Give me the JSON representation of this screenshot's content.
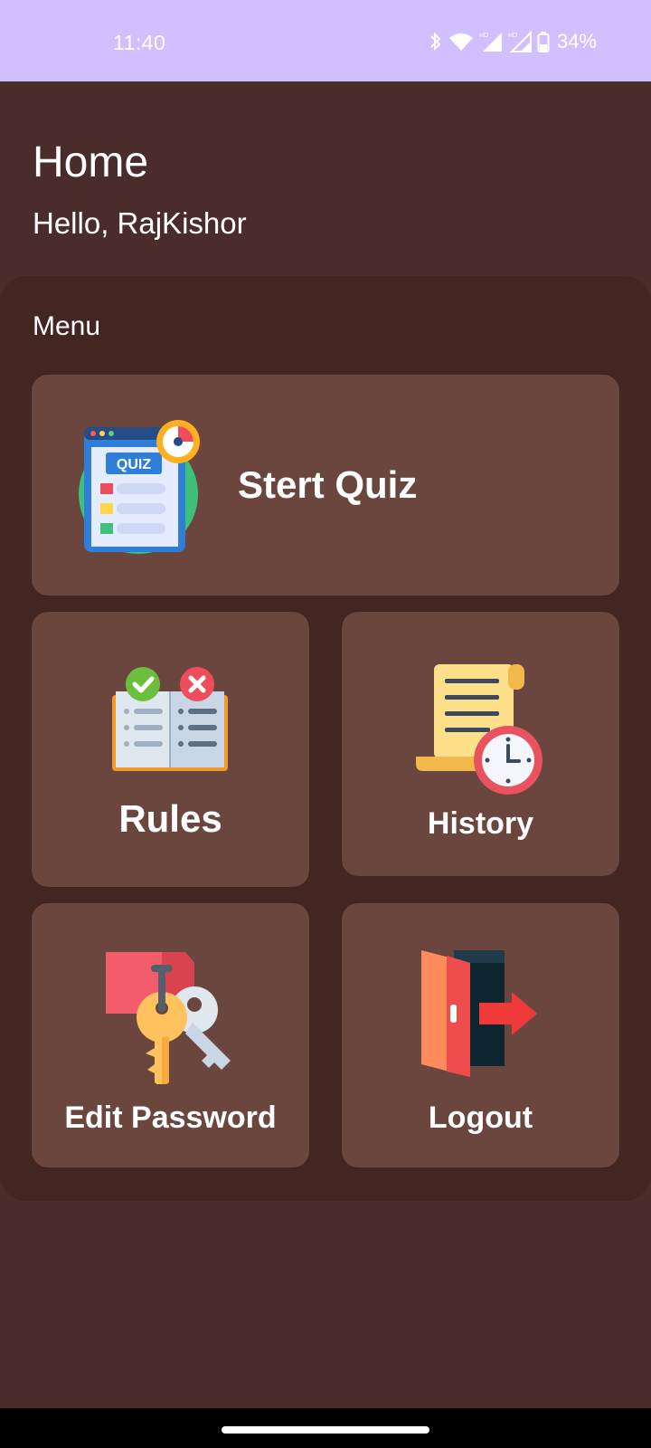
{
  "status_bar": {
    "time": "11:40",
    "battery": "34%",
    "icons": [
      "bluetooth-icon",
      "wifi-icon",
      "hd-signal-icon",
      "hd-signal-icon",
      "battery-icon"
    ]
  },
  "header": {
    "title": "Home",
    "greeting": "Hello, RajKishor"
  },
  "menu": {
    "label": "Menu",
    "items": [
      {
        "label": "Stert Quiz",
        "icon": "quiz-icon"
      },
      {
        "label": "Rules",
        "icon": "rules-book-icon"
      },
      {
        "label": "History",
        "icon": "history-scroll-icon"
      },
      {
        "label": "Edit Password",
        "icon": "keys-icon"
      },
      {
        "label": "Logout",
        "icon": "logout-door-icon"
      }
    ]
  },
  "colors": {
    "status_bar": "#d0c0ff",
    "background": "#4a2d2a",
    "panel": "#432522",
    "card": "#6b463e"
  }
}
